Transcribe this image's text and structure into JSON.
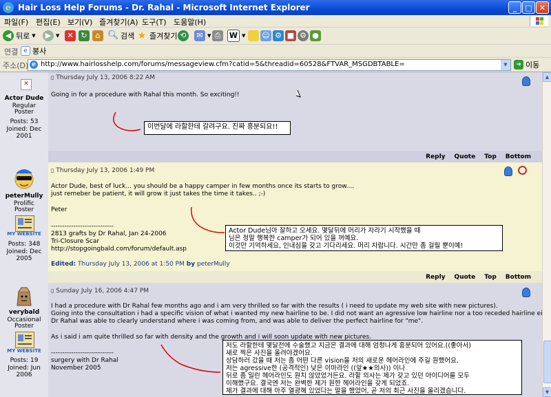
{
  "window": {
    "title": "Hair Loss Help Forums - Dr. Rahal - Microsoft Internet Explorer"
  },
  "menu": [
    "파일(F)",
    "편집(E)",
    "보기(V)",
    "즐겨찾기(A)",
    "도구(T)",
    "도움말(H)"
  ],
  "toolbar": {
    "back": "뒤로",
    "search": "검색",
    "favorites": "즐겨찾기"
  },
  "links": {
    "label": "연결",
    "item": "봉사"
  },
  "address": {
    "label": "주소(D)",
    "url": "http://www.hairlosshelp.com/forums/messageview.cfm?catid=5&threadid=60528&FTVAR_MSGDBTABLE=",
    "go": "이동"
  },
  "actions": {
    "reply": "Reply",
    "quote": "Quote",
    "top": "Top",
    "bottom": "Bottom"
  },
  "posts": [
    {
      "author": "Actor Dude",
      "rank1": "Regular",
      "rank2": "Poster",
      "posts_label": "Posts: 53",
      "joined1": "Joined: Dec",
      "joined2": "2001",
      "date": "Thursday July 13, 2006 8:22 AM",
      "lines": [
        "Going in for a procedure with Rahal this month. So exciting!!"
      ],
      "note": "이번달에 라할한테 갈려구요. 진짜 흥분되요!!"
    },
    {
      "author": "peterMully",
      "rank1": "Prolific",
      "rank2": "Poster",
      "website": "MY WEBSITE",
      "posts_label": "Posts: 348",
      "joined1": "Joined: Dec",
      "joined2": "2005",
      "date": "Thursday July 13, 2006 1:49 PM",
      "lines": [
        "Actor Dude, best of luck... you should be a happy camper in few months once its starts to grow....",
        "just remeber be patient, it will grow it just takes the time it takes.. ;-)",
        "",
        "Peter",
        "",
        "----------------------------",
        "2813 grafts by Dr Rahal, Jan 24-2006",
        "Tri-Closure Scar",
        "http://stopgoingbald.com/forum/default.asp"
      ],
      "edited_label": "Edited:",
      "edited_rest": "Thursday July 13, 2006 at 1:50 PM",
      "edited_by": "by",
      "edited_user": "peterMully",
      "note_lines": [
        "Actor Dude님아 잘하고 오세요. 몇달뒤에 머리가 자라기 시작했을 때",
        "님은 정말 행복한 camper가 되어 있을 꺼예요.",
        "이것만 기억하세요, 인내심을 갖고 기다리세요. 머리 자랍니다. 시간만 좀 걸릴 뿐이예!"
      ]
    },
    {
      "author": "verybald",
      "rank1": "Occasional",
      "rank2": "Poster",
      "website": "MY WEBSITE",
      "posts_label": "Posts: 19",
      "joined1": "Joined: Jun",
      "joined2": "2006",
      "date": "Sunday July 16, 2006 4:47 PM",
      "lines": [
        "I had a procedure with Dr Rahal few months ago and i am very thrilled so far with the results ( i need to update my web site with new pictures).",
        "Going into the consultation i had a specific vision of what i wanted my new hairline to be. I did not want an agressive low hairline nor a too receded hairline either.",
        "Dr Rahal was able to clearly understand where i was coming from, and was able to deliver the perfect hairline for \"me\".",
        "",
        "As i said i am quite thrilled so far with density and the growth and i will soon update with new pictures.",
        "",
        "----------------------------",
        "surgery with Dr Rahal",
        "November 2005"
      ],
      "note_lines": [
        "저도 라할한테 몇달전에 수술했고 지금은 결과에 대해 엄청나게 흥분되어 있어요.((좋아서)",
        "새로 찍은 사진을 올려야겠어요.",
        "상담하러 갔을 때  저는 좀 어떤 다른 vision을 저의 새로운 헤어라인에 주길 원했어요.",
        "저는 agressive한 (공격적인) 낮은 이마라인 ((앞★★의사)) 이나",
        "뒤로 좀 밀린 헤어라인도 원치 않았었거든요. 라할 의사는 제가 갖고 있던 아이디어를 모두",
        "이해했구요. 결국엔 저는 완벽한 제가 원한 헤어라인을 갖게 되었죠.",
        "제가 결과에 대해 아주 열광해 있었다는 말을 했었어, 곧 저의 최근 사진을 올리겠습니다."
      ]
    }
  ],
  "colors": {
    "post_bg_gray": "#d9d9e6",
    "post_bg_yellow": "#f5f3d2",
    "annotation": "#e00000",
    "titlebar": "#0a4bd6"
  }
}
